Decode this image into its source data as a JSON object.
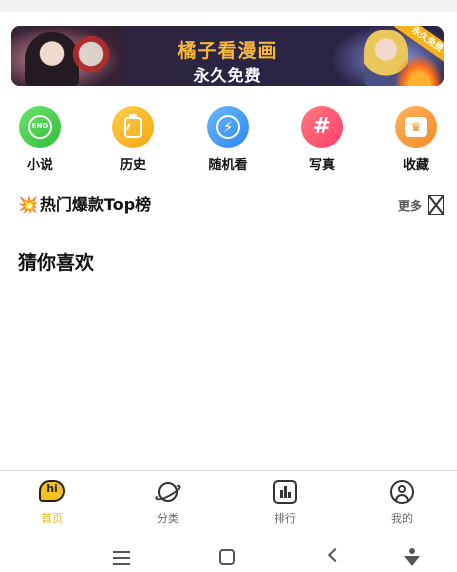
{
  "banner": {
    "title": "橘子看漫画",
    "subtitle": "永久免费",
    "ribbon": "永久免费"
  },
  "quick_nav": [
    {
      "label": "小说",
      "icon": "end-badge-icon",
      "icon_text": "END",
      "color": "#3cc93f"
    },
    {
      "label": "历史",
      "icon": "history-clipboard-icon",
      "color": "#f7b51f"
    },
    {
      "label": "随机看",
      "icon": "lightning-icon",
      "icon_text": "⚡",
      "color": "#3b92f3"
    },
    {
      "label": "写真",
      "icon": "hashtag-icon",
      "icon_text": "#",
      "color": "#ff4f6e"
    },
    {
      "label": "收藏",
      "icon": "crown-icon",
      "icon_text": "♛",
      "color": "#f6952e"
    }
  ],
  "hot_section": {
    "emoji": "💥",
    "title": "热门爆款Top榜",
    "more_label": "更多"
  },
  "guess_section": {
    "title": "猜你喜欢"
  },
  "tab_bar": {
    "active_color": "#f3b519",
    "tabs": [
      {
        "label": "首页",
        "icon": "home-bubble-icon",
        "icon_text": "hi",
        "active": true
      },
      {
        "label": "分类",
        "icon": "planet-icon",
        "active": false
      },
      {
        "label": "排行",
        "icon": "bar-chart-icon",
        "active": false
      },
      {
        "label": "我的",
        "icon": "user-icon",
        "active": false
      }
    ]
  }
}
